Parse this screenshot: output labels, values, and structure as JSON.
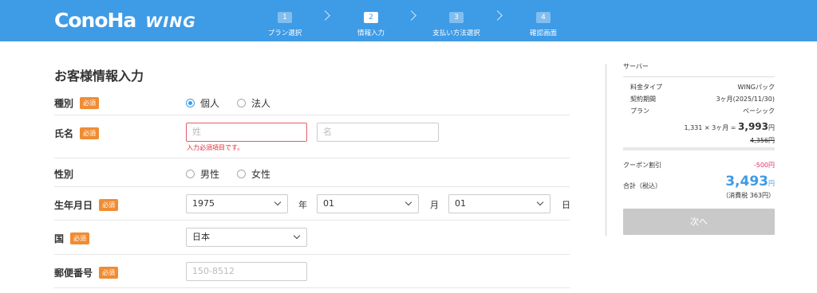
{
  "header": {
    "logo_main": "ConoHa",
    "logo_sub": "WING",
    "steps": [
      {
        "num": "1",
        "label": "プラン選択"
      },
      {
        "num": "2",
        "label": "情報入力"
      },
      {
        "num": "3",
        "label": "支払い方法選択"
      },
      {
        "num": "4",
        "label": "確認画面"
      }
    ]
  },
  "form": {
    "title": "お客様情報入力",
    "required_label": "必須",
    "type": {
      "label": "種別",
      "options": [
        "個人",
        "法人"
      ],
      "selected": "個人"
    },
    "name": {
      "label": "氏名",
      "last_placeholder": "姓",
      "first_placeholder": "名",
      "error": "入力必須項目です。"
    },
    "gender": {
      "label": "性別",
      "options": [
        "男性",
        "女性"
      ]
    },
    "birthdate": {
      "label": "生年月日",
      "year": "1975",
      "year_unit": "年",
      "month": "01",
      "month_unit": "月",
      "day": "01",
      "day_unit": "日"
    },
    "country": {
      "label": "国",
      "value": "日本"
    },
    "postal": {
      "label": "郵便番号",
      "placeholder": "150-8512"
    }
  },
  "summary": {
    "title": "サーバー",
    "fee_type_label": "料金タイプ",
    "fee_type_value": "WINGパック",
    "period_label": "契約期間",
    "period_value": "3ヶ月(2025/11/30)",
    "plan_label": "プラン",
    "plan_value": "ベーシック",
    "calc_text": "1,331 × 3ヶ月 =",
    "calc_price": "3,993",
    "yen": "円",
    "original_price": "4,356円",
    "coupon_label": "クーポン割引",
    "coupon_value": "-500円",
    "total_label": "合計（税込）",
    "total_price": "3,493",
    "tax_note": "（消費税 363円）",
    "next_button": "次へ"
  },
  "colors": {
    "header_bg": "#3e9be6",
    "required_badge": "#f08c33",
    "error": "#e0303c",
    "total": "#3e9be6",
    "coupon": "#e0306a"
  }
}
